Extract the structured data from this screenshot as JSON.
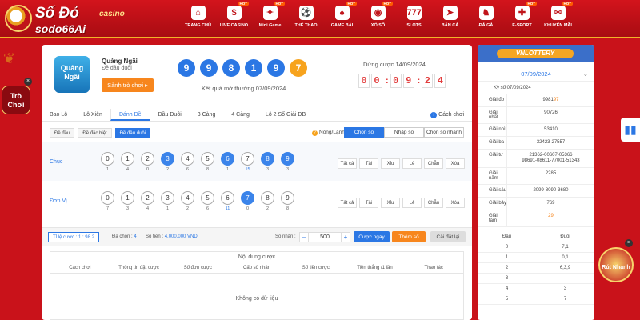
{
  "brand": {
    "name": "Số Đỏ",
    "casino": "casino",
    "domain": "sodo66Ai"
  },
  "nav": [
    {
      "label": "TRANG CHỦ",
      "icon": "home-icon",
      "glyph": "⌂",
      "hot": false
    },
    {
      "label": "LIVE CASINO",
      "icon": "casino-chip-icon",
      "glyph": "$",
      "hot": true
    },
    {
      "label": "Mini Game",
      "icon": "gamepad-icon",
      "glyph": "✦",
      "hot": true
    },
    {
      "label": "THỂ THAO",
      "icon": "soccer-ball-icon",
      "glyph": "⚽",
      "hot": false
    },
    {
      "label": "GAME BÀI",
      "icon": "cards-icon",
      "glyph": "♠",
      "hot": true
    },
    {
      "label": "XỔ SỐ",
      "icon": "lottery-ball-icon",
      "glyph": "◉",
      "hot": true
    },
    {
      "label": "SLOTS",
      "icon": "slot-machine-icon",
      "glyph": "777",
      "hot": false
    },
    {
      "label": "BẮN CÁ",
      "icon": "fish-icon",
      "glyph": "➤",
      "hot": false
    },
    {
      "label": "ĐÁ GÀ",
      "icon": "rooster-icon",
      "glyph": "♞",
      "hot": false
    },
    {
      "label": "E-SPORT",
      "icon": "controller-icon",
      "glyph": "✚",
      "hot": true
    },
    {
      "label": "KHUYẾN MÃI",
      "icon": "gift-icon",
      "glyph": "✉",
      "hot": true
    }
  ],
  "nav_hot_label": "HOT",
  "left_side": {
    "tro_choi": "Trò Chơi",
    "close": "×"
  },
  "game": {
    "thumb_text": "Quảng Ngãi",
    "name": "Quảng Ngãi",
    "subtitle": "Đề đầu đuôi",
    "play_button": "Sảnh trò chơi ▸"
  },
  "draw": {
    "balls": [
      {
        "v": "9",
        "c": "blue"
      },
      {
        "v": "9",
        "c": "blue"
      },
      {
        "v": "8",
        "c": "blue"
      },
      {
        "v": "1",
        "c": "blue"
      },
      {
        "v": "9",
        "c": "blue"
      },
      {
        "v": "7",
        "c": "orange"
      }
    ],
    "result_label": "Kết quả mở thưởng 07/09/2024",
    "stop_label": "Dừng cược 14/09/2024",
    "timer": [
      "0",
      "0",
      "0",
      "9",
      "2",
      "4"
    ]
  },
  "tabs": [
    "Bao Lô",
    "Lô Xiên",
    "Đánh Đề",
    "Đầu Đuôi",
    "3 Càng",
    "4 Càng",
    "Lô 2 Số Giải ĐB"
  ],
  "active_tab": 2,
  "how_to_play": "Cách chơi",
  "subtabs": [
    "Đề đầu",
    "Đề đặc biệt",
    "Đề đầu đuôi"
  ],
  "active_subtab": 2,
  "hot_cold": "Nóng/Lạnh",
  "modes": [
    "Chọn số",
    "Nhập số",
    "Chọn số nhanh"
  ],
  "active_mode": 0,
  "rows": [
    {
      "label": "Chục",
      "digits": [
        "0",
        "1",
        "2",
        "3",
        "4",
        "5",
        "6",
        "7",
        "8",
        "9"
      ],
      "counts": [
        "1",
        "4",
        "0",
        "2",
        "6",
        "8",
        "1",
        "15",
        "3",
        "3"
      ],
      "selected": [
        3,
        6,
        8,
        9
      ],
      "highlight": [
        7
      ]
    },
    {
      "label": "Đơn Vị",
      "digits": [
        "0",
        "1",
        "2",
        "3",
        "4",
        "5",
        "6",
        "7",
        "8",
        "9"
      ],
      "counts": [
        "7",
        "3",
        "4",
        "1",
        "2",
        "6",
        "11",
        "0",
        "2",
        "8"
      ],
      "selected": [
        7
      ],
      "highlight": [
        6
      ]
    }
  ],
  "quick_buttons": [
    "Tất cả",
    "Tài",
    "Xỉu",
    "Lẻ",
    "Chẵn",
    "Xóa"
  ],
  "bet": {
    "rate_label": "Tỉ lệ cược : 1 : 98.2",
    "selected_label": "Đã chọn :",
    "selected_value": "4",
    "amount_label": "Số tiền :",
    "amount_value": "4,000,000 VND",
    "qty_label": "Số nhân :",
    "qty_value": "500",
    "minus": "–",
    "plus": "+",
    "quick_bet": "Cược ngay",
    "add_number": "Thêm số",
    "reset": "Cài đặt lại"
  },
  "content": {
    "title": "Nội dung cược",
    "columns": [
      "Cách chơi",
      "Thông tin đặt cược",
      "Số đơn cược",
      "Cấp số nhân",
      "Số tiền cược",
      "Tiền thắng /1 lần",
      "Thao tác"
    ],
    "empty": "Không có dữ liệu"
  },
  "results": {
    "logo": "VNLOTTERY",
    "date": "07/09/2024",
    "chevron": "⌄",
    "ky_so": "Kỳ số 07/09/2024",
    "prizes": [
      {
        "name": "Giải đb",
        "value": "9981",
        "accent": "97"
      },
      {
        "name": "Giải nhất",
        "value": "90726",
        "accent": ""
      },
      {
        "name": "Giải nhì",
        "value": "53410",
        "accent": ""
      },
      {
        "name": "Giải ba",
        "value": "32423-27557",
        "accent": ""
      },
      {
        "name": "Giải tư",
        "value": "21362-00607-05366\n98691-08611-77001-51343",
        "accent": ""
      },
      {
        "name": "Giải năm",
        "value": "2285",
        "accent": ""
      },
      {
        "name": "Giải sáu",
        "value": "2099-8090-3680",
        "accent": ""
      },
      {
        "name": "Giải bảy",
        "value": "769",
        "accent": ""
      },
      {
        "name": "Giải tám",
        "value": "",
        "accent": "29"
      }
    ],
    "dd_head": [
      "Đầu",
      "Đuôi"
    ],
    "dd_rows": [
      [
        "0",
        "7,1"
      ],
      [
        "1",
        "0,1"
      ],
      [
        "2",
        "6,3,9"
      ],
      [
        "3",
        ""
      ],
      [
        "4",
        "3"
      ],
      [
        "5",
        "7"
      ]
    ]
  },
  "right_side": {
    "rut_nhanh": "Rút Nhanh",
    "close": "×",
    "stats_icon": "bar-chart-icon"
  },
  "colors": {
    "brand_red": "#c9121a",
    "accent_blue": "#2b77e4",
    "accent_orange": "#f7861d"
  }
}
